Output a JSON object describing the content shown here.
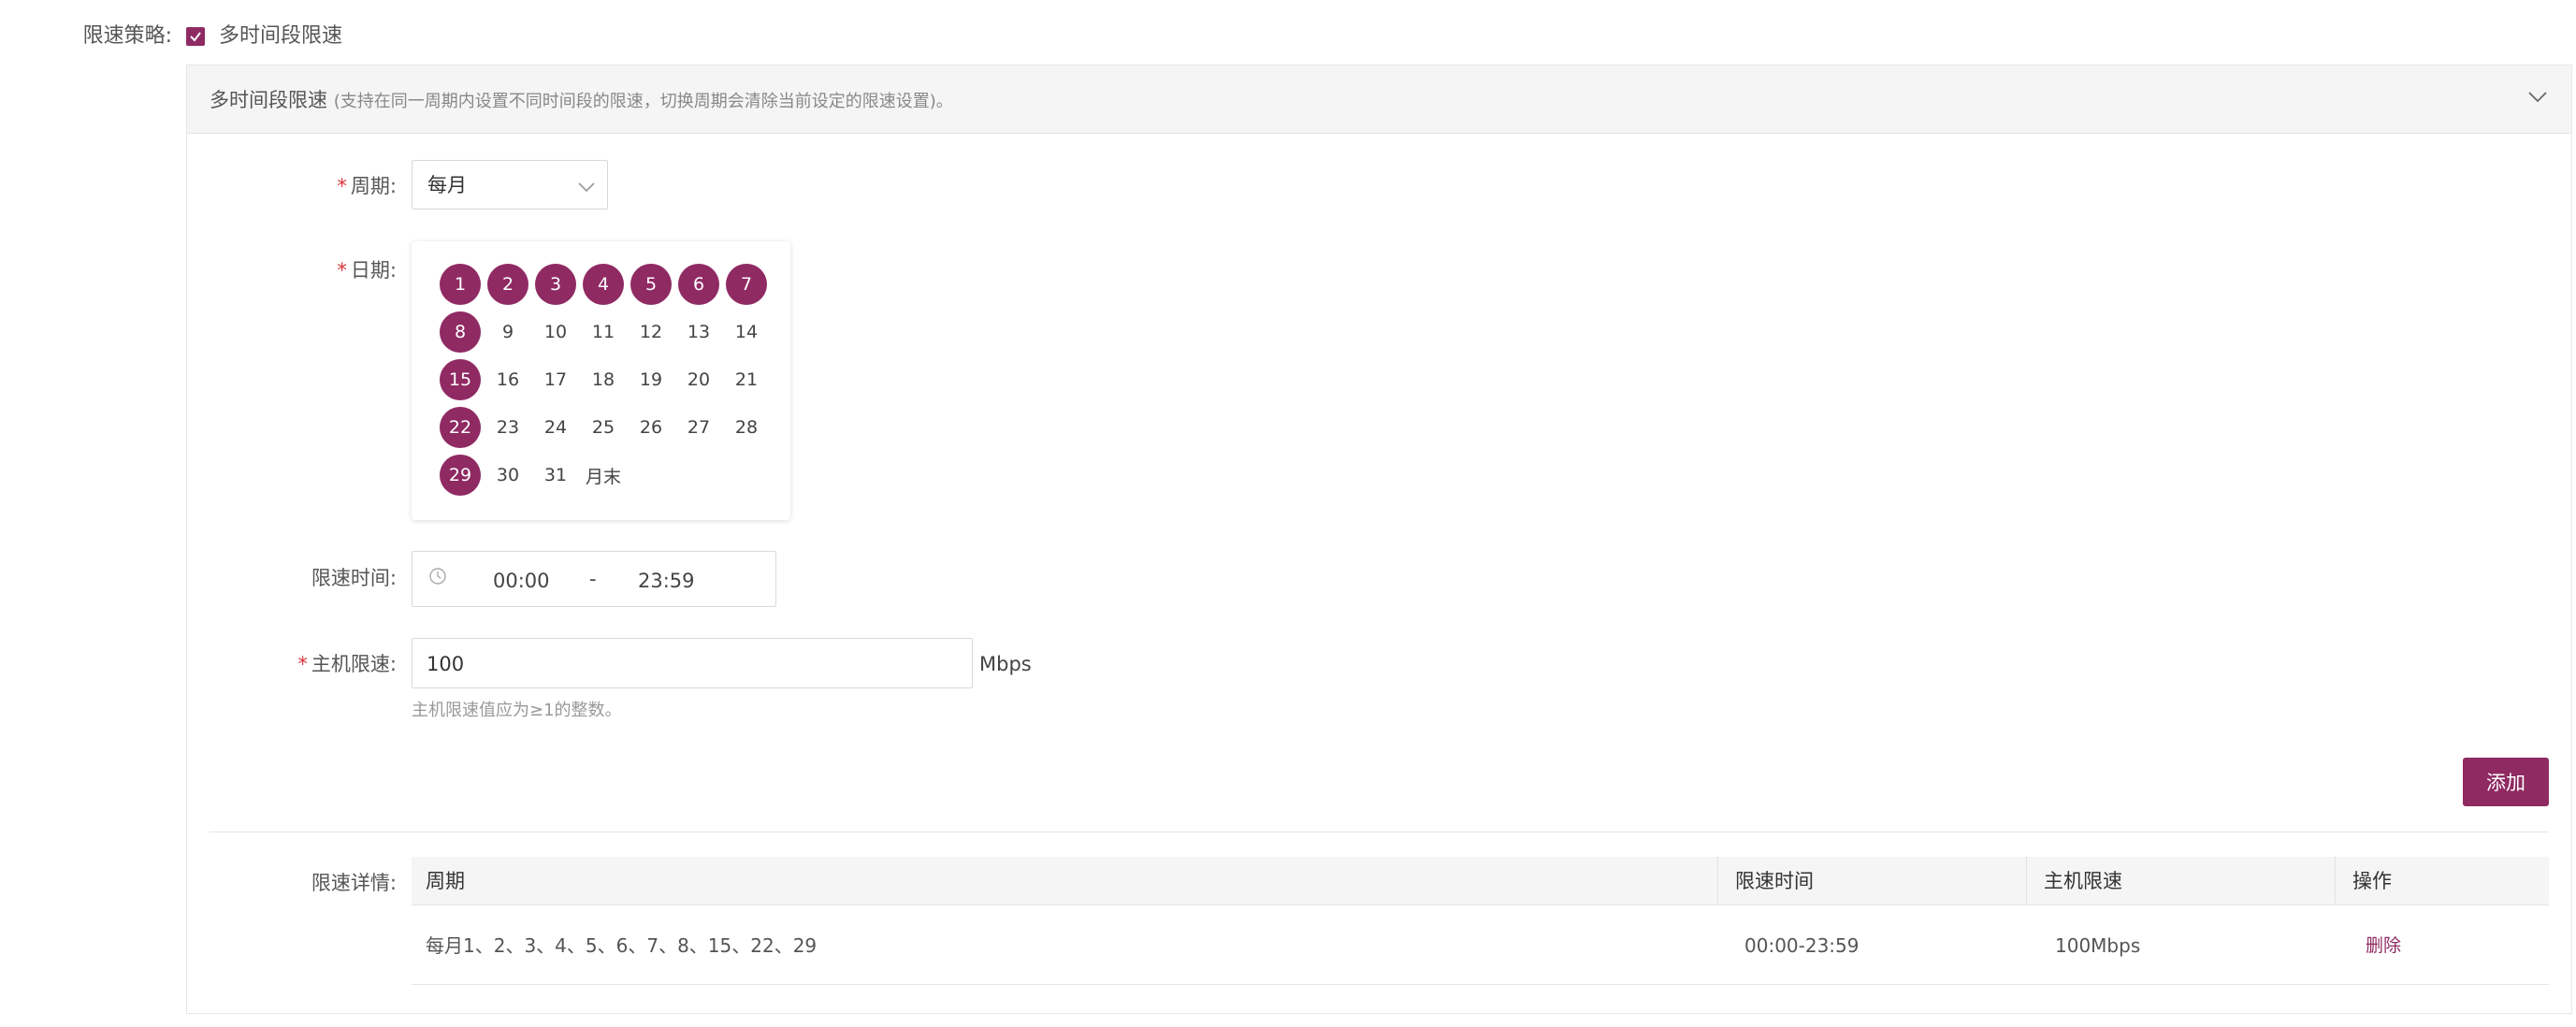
{
  "strategy": {
    "label": "限速策略:",
    "checkbox_label": "多时间段限速",
    "checked": true
  },
  "panel": {
    "title": "多时间段限速",
    "subtitle": "(支持在同一周期内设置不同时间段的限速，切换周期会清除当前设定的限速设置)。"
  },
  "form": {
    "period_label": "周期:",
    "period_value": "每月",
    "date_label": "日期:",
    "time_label": "限速时间:",
    "time_start": "00:00",
    "time_separator": "-",
    "time_end": "23:59",
    "speed_label": "主机限速:",
    "speed_value": "100",
    "speed_unit": "Mbps",
    "speed_hint": "主机限速值应为≥1的整数。",
    "required_mark": "*"
  },
  "calendar": {
    "days": [
      "1",
      "2",
      "3",
      "4",
      "5",
      "6",
      "7",
      "8",
      "9",
      "10",
      "11",
      "12",
      "13",
      "14",
      "15",
      "16",
      "17",
      "18",
      "19",
      "20",
      "21",
      "22",
      "23",
      "24",
      "25",
      "26",
      "27",
      "28",
      "29",
      "30",
      "31",
      "月末"
    ],
    "selected": [
      "1",
      "2",
      "3",
      "4",
      "5",
      "6",
      "7",
      "8",
      "15",
      "22",
      "29"
    ]
  },
  "actions": {
    "add_label": "添加"
  },
  "details": {
    "label": "限速详情:",
    "columns": [
      "周期",
      "限速时间",
      "主机限速",
      "操作"
    ],
    "rows": [
      {
        "period": "每月1、2、3、4、5、6、7、8、15、22、29",
        "time": "00:00-23:59",
        "speed": "100Mbps",
        "action": "删除"
      }
    ]
  },
  "colors": {
    "accent": "#8f2a63",
    "required": "#d9363e"
  },
  "icons": {
    "check": "check-icon",
    "collapse": "chevron-down-icon",
    "select_arrow": "chevron-down-icon",
    "clock": "clock-icon"
  }
}
